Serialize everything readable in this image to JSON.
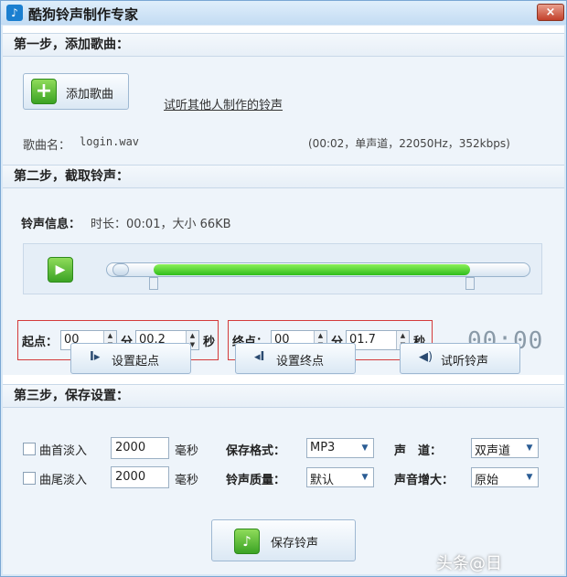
{
  "window": {
    "title": "酷狗铃声制作专家",
    "close_label": "×"
  },
  "step1": {
    "heading": "第一步，添加歌曲：",
    "add_button": "添加歌曲",
    "listen_link": "试听其他人制作的铃声",
    "song_name_label": "歌曲名：",
    "song_name": "login.wav",
    "song_info": "(00:02，单声道，22050Hz，352kbps)"
  },
  "step2": {
    "heading": "第二步，截取铃声：",
    "info_label": "铃声信息：",
    "info_value": "时长：00:01，大小 66KB",
    "start_label": "起点：",
    "start_min": "00",
    "start_sec": "00.2",
    "end_label": "终点：",
    "end_min": "00",
    "end_sec": "01.7",
    "min_unit": "分",
    "sec_unit": "秒",
    "time_display": "00:00",
    "set_start_button": "设置起点",
    "set_end_button": "设置终点",
    "preview_button": "试听铃声",
    "selection": {
      "start_fraction": 0.11,
      "end_fraction": 0.86
    }
  },
  "step3": {
    "heading": "第三步，保存设置：",
    "fade_in_label": "曲首淡入",
    "fade_in_value": "2000",
    "fade_out_label": "曲尾淡入",
    "fade_out_value": "2000",
    "ms_unit": "毫秒",
    "format_label": "保存格式：",
    "format_value": "MP3",
    "quality_label": "铃声质量：",
    "quality_value": "默认",
    "channel_label": "声　道：",
    "channel_value": "双声道",
    "boost_label": "声音增大：",
    "boost_value": "原始",
    "save_button": "保存铃声"
  },
  "watermark": "头条@日"
}
